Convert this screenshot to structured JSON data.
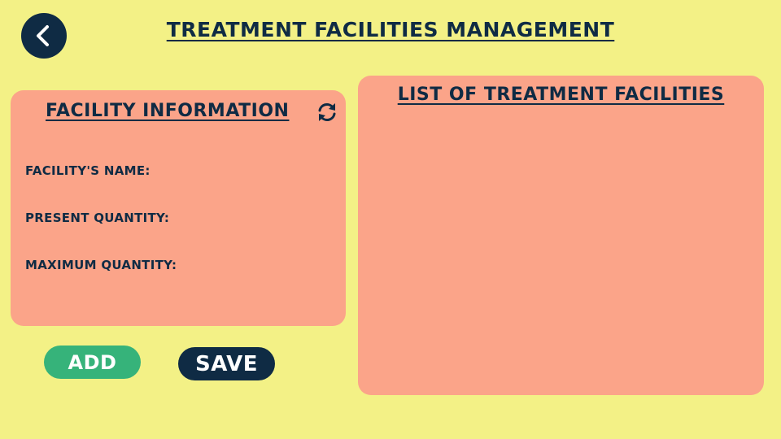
{
  "header": {
    "title": "TREATMENT FACILITIES MANAGEMENT",
    "back_icon": "chevron-left-icon"
  },
  "facility_panel": {
    "title": "FACILITY INFORMATION",
    "refresh_icon": "refresh-icon",
    "fields": [
      {
        "label": "FACILITY'S NAME:"
      },
      {
        "label": "PRESENT QUANTITY:"
      },
      {
        "label": "MAXIMUM QUANTITY:"
      }
    ]
  },
  "list_panel": {
    "title": "LIST OF TREATMENT FACILITIES"
  },
  "actions": {
    "add_label": "ADD",
    "save_label": "SAVE"
  },
  "colors": {
    "background": "#f3f186",
    "navy": "#0f2b44",
    "panel": "#fba489",
    "add_green": "#36b37a"
  }
}
